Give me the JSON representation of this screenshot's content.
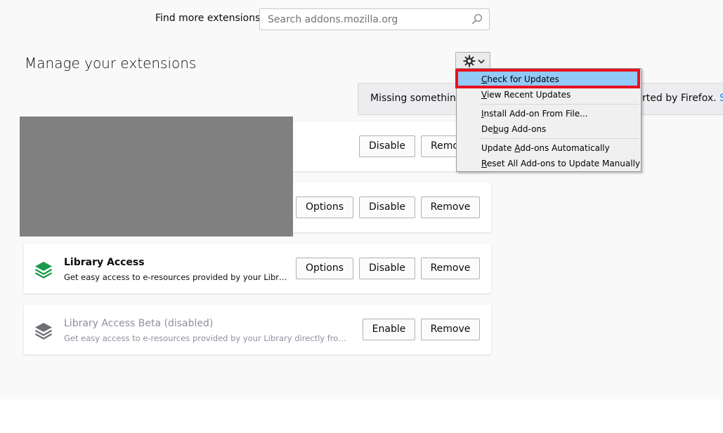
{
  "header": {
    "find_label": "Find more extensions",
    "search_placeholder": "Search addons.mozilla.org",
    "search_icon": "search-icon"
  },
  "page_title": "Manage your extensions",
  "tools_button": {
    "icon": "gear-icon",
    "chevron": "chevron-down-icon"
  },
  "notice": {
    "text_left": "Missing something",
    "text_right": "rted by Firefox.",
    "link_text": "Sh"
  },
  "extensions": [
    {
      "name": "",
      "description": "",
      "buttons": [
        "Disable",
        "Remo"
      ]
    },
    {
      "name": "",
      "description": "",
      "buttons": [
        "Options",
        "Disable",
        "Remove"
      ]
    },
    {
      "name": "Library Access",
      "description": "Get easy access to e-resources provided by your Library directly from your browser",
      "icon": "layers-icon",
      "icon_color": "#1a9a4a",
      "buttons": [
        "Options",
        "Disable",
        "Remove"
      ]
    },
    {
      "name": "Library Access Beta (disabled)",
      "description": "Get easy access to e-resources provided by your Library directly from your browser",
      "icon": "layers-icon",
      "icon_color": "#8f8f9d",
      "buttons": [
        "Enable",
        "Remove"
      ]
    }
  ],
  "tools_menu": {
    "items": [
      {
        "label": "Check for Updates",
        "accel": "C",
        "rest": "heck for Updates",
        "highlighted": true
      },
      {
        "label": "View Recent Updates",
        "accel": "V",
        "rest": "iew Recent Updates"
      },
      {
        "label": "Install Add-on From File...",
        "accel": "I",
        "rest": "nstall Add-on From File..."
      },
      {
        "label": "Debug Add-ons",
        "pre": "De",
        "accel": "b",
        "rest": "ug Add-ons"
      },
      {
        "label": "Update Add-ons Automatically",
        "pre": "Update ",
        "accel": "A",
        "rest": "dd-ons Automatically"
      },
      {
        "label": "Reset All Add-ons to Update Manually",
        "accel": "R",
        "rest": "eset All Add-ons to Update Manually"
      }
    ]
  },
  "colors": {
    "highlight": "#91c9f7",
    "callout_red": "#e8101e",
    "link_blue": "#0a84ff",
    "redaction_gray": "#808080"
  }
}
